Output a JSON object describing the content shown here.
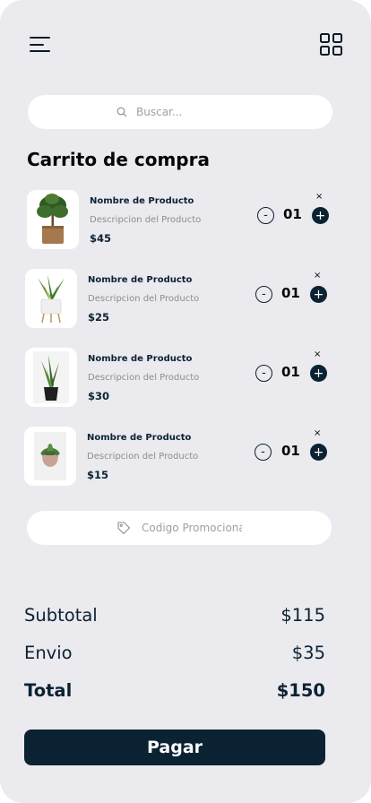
{
  "header": {
    "menu_icon": "menu-icon",
    "grid_icon": "grid-view-icon"
  },
  "search": {
    "placeholder": "Buscar..."
  },
  "cart": {
    "title": "Carrito de compra",
    "items": [
      {
        "name": "Nombre de Producto",
        "description": "Descripcion del Producto",
        "price": "$45",
        "quantity": "01",
        "image": "olive-tree-plant"
      },
      {
        "name": "Nombre de Producto",
        "description": "Descripcion del Producto",
        "price": "$25",
        "quantity": "01",
        "image": "snake-plant-white-pot"
      },
      {
        "name": "Nombre de Producto",
        "description": "Descripcion del Producto",
        "price": "$30",
        "quantity": "01",
        "image": "snake-plant-black-pot"
      },
      {
        "name": "Nombre de Producto",
        "description": "Descripcion del Producto",
        "price": "$15",
        "quantity": "01",
        "image": "succulent-pot"
      }
    ],
    "minus_label": "-",
    "plus_label": "+",
    "remove_label": "×"
  },
  "promo": {
    "placeholder": "Codigo Promocional"
  },
  "summary": {
    "subtotal_label": "Subtotal",
    "subtotal_value": "$115",
    "shipping_label": "Envio",
    "shipping_value": "$35",
    "total_label": "Total",
    "total_value": "$150"
  },
  "pay_button": {
    "label": "Pagar"
  },
  "colors": {
    "primary": "#0b2233",
    "background": "#ebeaee",
    "card": "#ffffff"
  }
}
